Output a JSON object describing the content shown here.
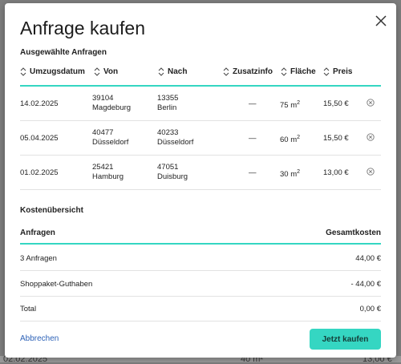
{
  "dialog": {
    "title": "Anfrage kaufen",
    "selected_heading": "Ausgewählte Anfragen",
    "columns": [
      "Umzugsdatum",
      "Von",
      "Nach",
      "Zusatzinfo",
      "Fläche",
      "Preis"
    ],
    "rows": [
      {
        "date": "14.02.2025",
        "from_zip": "39104",
        "from_city": "Magdeburg",
        "to_zip": "13355",
        "to_city": "Berlin",
        "extra": "—",
        "area": "75 m",
        "area_unit": "2",
        "price": "15,50 €"
      },
      {
        "date": "05.04.2025",
        "from_zip": "40477",
        "from_city": "Düsseldorf",
        "to_zip": "40233",
        "to_city": "Düsseldorf",
        "extra": "—",
        "area": "60 m",
        "area_unit": "2",
        "price": "15,50 €"
      },
      {
        "date": "01.02.2025",
        "from_zip": "25421",
        "from_city": "Hamburg",
        "to_zip": "47051",
        "to_city": "Duisburg",
        "extra": "—",
        "area": "30 m",
        "area_unit": "2",
        "price": "13,00 €"
      }
    ],
    "costs_heading": "Kostenübersicht",
    "costs_col_left": "Anfragen",
    "costs_col_right": "Gesamtkosten",
    "costs": [
      {
        "label": "3 Anfragen",
        "value": "44,00 €"
      },
      {
        "label": "Shoppaket-Guthaben",
        "value": "- 44,00 €"
      },
      {
        "label": "Total",
        "value": "0,00 €"
      }
    ],
    "cancel_label": "Abbrechen",
    "buy_label": "Jetzt kaufen"
  },
  "background": {
    "left_text": "02.02.2025",
    "mid_text": "40 m²",
    "right_text": "13,00 €"
  },
  "colors": {
    "accent": "#35d6c2",
    "link": "#2d62b7",
    "overlay": "#7d7d7d"
  },
  "icons": {
    "close": "close-icon",
    "remove": "remove-circle-icon",
    "sort": "sort-arrows-icon"
  }
}
